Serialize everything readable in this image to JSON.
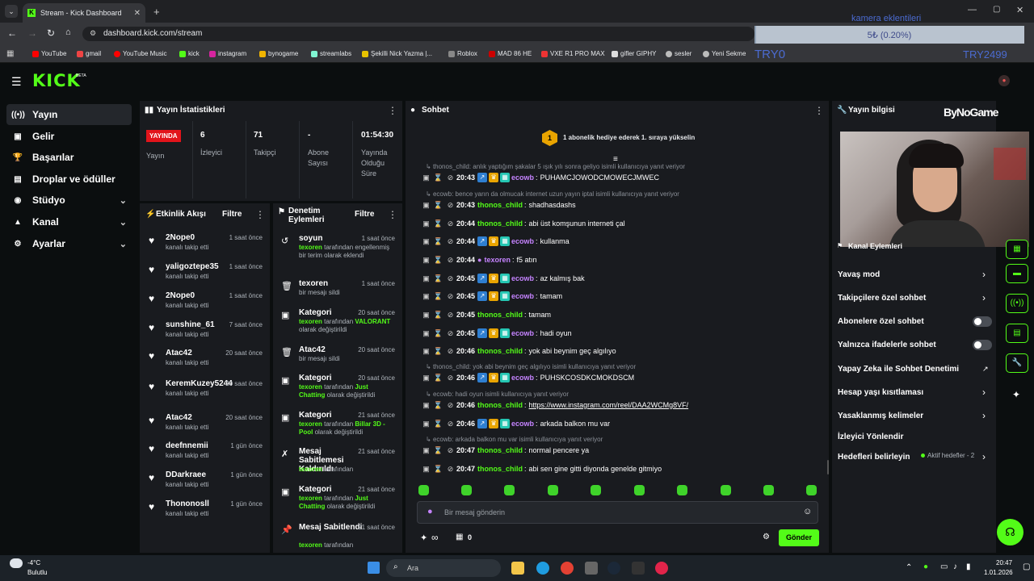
{
  "browser": {
    "tab_title": "Stream - Kick Dashboard",
    "url": "dashboard.kick.com/stream",
    "bookmarks": [
      "YouTube",
      "gmail",
      "YouTube Music",
      "kick",
      "instagram",
      "bynogame",
      "streamlabs",
      "Şekilli Nick Yazma |...",
      "Roblox",
      "MAD 86 HE",
      "VXE R1 PRO MAX",
      "gifler GIPHY",
      "sesler",
      "Yeni Sekme"
    ],
    "overlay_title": "kamera eklentileri",
    "overlay_progress": "5₺ (0.20%)",
    "overlay_progress_fraction": 0.002,
    "overlay_left_text": "TRY0",
    "overlay_right_text": "TRY2499"
  },
  "kick": {
    "logo": "KICK",
    "logo_beta": "BETA"
  },
  "sidebar": {
    "items": [
      {
        "label": "Yayın",
        "icon": "broadcast-icon"
      },
      {
        "label": "Gelir",
        "icon": "revenue-icon"
      },
      {
        "label": "Başarılar",
        "icon": "trophy-icon"
      },
      {
        "label": "Droplar ve ödüller",
        "icon": "gift-icon"
      },
      {
        "label": "Stüdyo",
        "icon": "studio-icon"
      },
      {
        "label": "Kanal",
        "icon": "channel-icon"
      },
      {
        "label": "Ayarlar",
        "icon": "gear-icon"
      }
    ]
  },
  "stats": {
    "title": "Yayın İstatistikleri",
    "live_badge": "YAYINDA",
    "live_label": "Yayın",
    "viewers": "6",
    "viewers_label": "İzleyici",
    "followers": "71",
    "followers_label": "Takipçi",
    "subs": "-",
    "subs_label": "Abone Sayısı",
    "uptime": "01:54:30",
    "uptime_label": "Yayında Olduğu Süre"
  },
  "activity": {
    "title": "Etkinlik Akışı",
    "filter": "Filtre",
    "items": [
      {
        "name": "2Nope0",
        "sub": "kanalı takip etti",
        "time": "1 saat önce"
      },
      {
        "name": "yaligoztepe35",
        "sub": "kanalı takip etti",
        "time": "1 saat önce"
      },
      {
        "name": "2Nope0",
        "sub": "kanalı takip etti",
        "time": "1 saat önce"
      },
      {
        "name": "sunshine_61",
        "sub": "kanalı takip etti",
        "time": "7 saat önce"
      },
      {
        "name": "Atac42",
        "sub": "kanalı takip etti",
        "time": "20 saat önce"
      },
      {
        "name": "KeremKuzey5244",
        "sub": "kanalı takip etti",
        "time": "20 saat önce"
      },
      {
        "name": "Atac42",
        "sub": "kanalı takip etti",
        "time": "20 saat önce"
      },
      {
        "name": "deefnnemii",
        "sub": "kanalı takip etti",
        "time": "1 gün önce"
      },
      {
        "name": "DDarkraee",
        "sub": "kanalı takip etti",
        "time": "1 gün önce"
      },
      {
        "name": "Thononosll",
        "sub": "kanalı takip etti",
        "time": "1 gün önce"
      }
    ]
  },
  "moderation": {
    "title": "Denetim Eylemleri",
    "filter": "Filtre",
    "items": [
      {
        "title": "soyun",
        "time": "1 saat önce",
        "actor": "texoren",
        "desc": " tarafından engellenmiş bir terim olarak eklendi",
        "icon": "undo-icon"
      },
      {
        "title": "texoren",
        "time": "1 saat önce",
        "actor": "",
        "desc": "bir mesajı sildi",
        "icon": "trash-icon"
      },
      {
        "title": "Kategori",
        "time": "20 saat önce",
        "actor": "texoren",
        "desc": " tarafından ",
        "extra": "VALORANT",
        "desc2": " olarak değiştirildi",
        "icon": "category-icon"
      },
      {
        "title": "Atac42",
        "time": "20 saat önce",
        "actor": "",
        "desc": "bir mesajı sildi",
        "icon": "trash-icon"
      },
      {
        "title": "Kategori",
        "time": "20 saat önce",
        "actor": "texoren",
        "desc": " tarafından ",
        "extra": "Just Chatting",
        "desc2": " olarak değiştirildi",
        "icon": "category-icon"
      },
      {
        "title": "Kategori",
        "time": "21 saat önce",
        "actor": "texoren",
        "desc": " tarafından ",
        "extra": "Billar 3D - Pool",
        "desc2": " olarak değiştirildi",
        "icon": "category-icon"
      },
      {
        "title": "Mesaj Sabitlemesi Kaldırıldı",
        "time": "21 saat önce",
        "actor": "texoren",
        "desc": " tarafından",
        "icon": "unpin-icon"
      },
      {
        "title": "Kategori",
        "time": "21 saat önce",
        "actor": "texoren",
        "desc": " tarafından ",
        "extra": "Just Chatting",
        "desc2": " olarak değiştirildi",
        "icon": "category-icon"
      },
      {
        "title": "Mesaj Sabitlendi",
        "time": "21 saat önce",
        "actor": "texoren",
        "desc": " tarafından",
        "icon": "pin-icon"
      }
    ]
  },
  "chat": {
    "title": "Sohbet",
    "banner_num": "1",
    "banner": "1 abonelik hediye ederek 1. sıraya yükselin",
    "messages": [
      {
        "reply": "thonos_child: anlık yaptığım şakalar 5 ışık yılı sonra geliyo isimli kullanıcıya yanıt veriyor",
        "time": "20:43",
        "user": "ecowb",
        "text": "PUHAMCJOWODCMOWECJMWEC",
        "badges": true
      },
      {
        "reply": "ecowb: bence yarın da olmucak internet uzun yayın iptal isimli kullanıcıya yanıt veriyor",
        "time": "20:43",
        "user": "thonos_child",
        "text": "shadhasdashs",
        "badges": false
      },
      {
        "time": "20:44",
        "user": "thonos_child",
        "text": "abi üst komşunun interneti çal",
        "badges": false
      },
      {
        "time": "20:44",
        "user": "ecowb",
        "text": "kullanma",
        "badges": true
      },
      {
        "time": "20:44",
        "user": "texoren",
        "text": "f5 atın",
        "badges": false,
        "mic": true
      },
      {
        "time": "20:45",
        "user": "ecowb",
        "text": "az kalmış bak",
        "badges": true
      },
      {
        "time": "20:45",
        "user": "ecowb",
        "text": "tamam",
        "badges": true
      },
      {
        "time": "20:45",
        "user": "thonos_child",
        "text": "tamam",
        "badges": false
      },
      {
        "time": "20:45",
        "user": "ecowb",
        "text": "hadi oyun",
        "badges": true
      },
      {
        "time": "20:46",
        "user": "thonos_child",
        "text": "yok abi beynim geç algılıyo",
        "badges": false
      },
      {
        "reply": "thonos_child: yok abi beynim geç algılıyo isimli kullanıcıya yanıt veriyor",
        "time": "20:46",
        "user": "ecowb",
        "text": "PUHSKCOSDKCMOKDSCM",
        "badges": true
      },
      {
        "reply": "ecowb: hadi oyun isimli kullanıcıya yanıt veriyor",
        "time": "20:46",
        "user": "thonos_child",
        "text": "https://www.instagram.com/reel/DAA2WCMg8VF/",
        "badges": false,
        "link": true
      },
      {
        "time": "20:46",
        "user": "ecowb",
        "text": "arkada balkon mu var",
        "badges": true
      },
      {
        "reply": "ecowb: arkada balkon mu var isimli kullanıcıya yanıt veriyor",
        "time": "20:47",
        "user": "thonos_child",
        "text": "normal pencere ya",
        "badges": false
      },
      {
        "time": "20:47",
        "user": "thonos_child",
        "text": "abi sen gine gitti diyonda genelde gitmiyo",
        "badges": false
      }
    ],
    "input_placeholder": "Bir mesaj gönderin",
    "points": "∞",
    "store_count": "0",
    "send": "Gönder"
  },
  "stream_info": {
    "title": "Yayın bilgisi",
    "sponsor": "ByNoGame",
    "chat_actions_label": "Kanal Eylemleri",
    "settings": [
      {
        "label": "Yavaş mod",
        "control": "chevron"
      },
      {
        "label": "Takipçilere özel sohbet",
        "control": "chevron"
      },
      {
        "label": "Abonelere özel sohbet",
        "control": "toggle"
      },
      {
        "label": "Yalnızca ifadelerle sohbet",
        "control": "toggle"
      },
      {
        "label": "Yapay Zeka ile Sohbet Denetimi",
        "control": "external"
      },
      {
        "label": "Hesap yaşı kısıtlaması",
        "control": "chevron"
      },
      {
        "label": "Yasaklanmış kelimeler",
        "control": "chevron"
      },
      {
        "label": "İzleyici Yönlendir",
        "control": "none"
      },
      {
        "label": "Hedefleri belirleyin",
        "control": "chevron",
        "status": "Aktif hedefler - 2"
      }
    ]
  },
  "taskbar": {
    "weather_temp": "-4°C",
    "weather_desc": "Bulutlu",
    "search": "Ara",
    "time": "20:47",
    "date": "1.01.2026"
  },
  "colors": {
    "accent": "#53fc18",
    "panel": "#191b1f",
    "bg": "#0b0e0f",
    "live": "#e2141b"
  }
}
